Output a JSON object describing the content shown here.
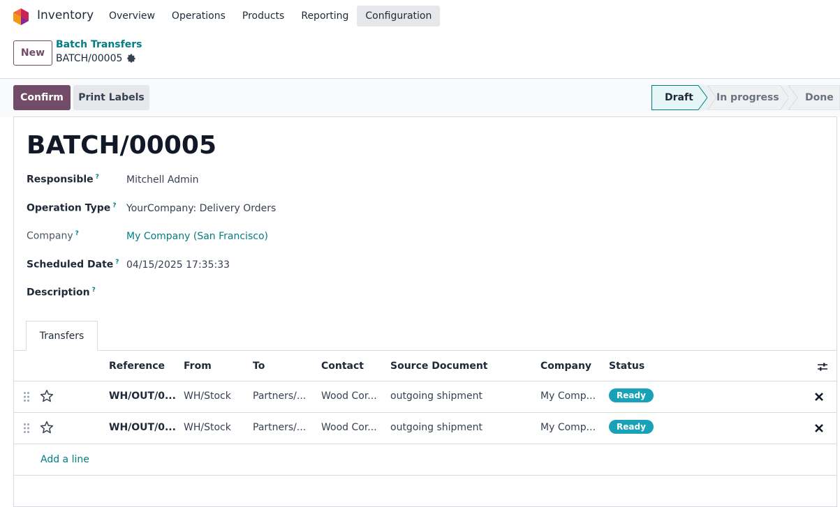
{
  "navbar": {
    "app_name": "Inventory",
    "menu": [
      "Overview",
      "Operations",
      "Products",
      "Reporting",
      "Configuration"
    ],
    "active_menu": "Configuration"
  },
  "control": {
    "new_label": "New",
    "breadcrumb_parent": "Batch Transfers",
    "record_name": "BATCH/00005"
  },
  "actions": {
    "confirm_label": "Confirm",
    "print_labels_label": "Print Labels"
  },
  "stages": [
    {
      "label": "Draft",
      "active": true
    },
    {
      "label": "In progress",
      "active": false
    },
    {
      "label": "Done",
      "active": false
    }
  ],
  "form": {
    "title": "BATCH/00005",
    "fields": [
      {
        "label": "Responsible",
        "help": "?",
        "value": "Mitchell Admin"
      },
      {
        "label": "Operation Type",
        "help": "?",
        "value": "YourCompany: Delivery Orders"
      },
      {
        "label": "Company",
        "help": "?",
        "value": "My Company (San Francisco)"
      },
      {
        "label": "Scheduled Date",
        "help": "?",
        "value": "04/15/2025 17:35:33"
      },
      {
        "label": "Description",
        "help": "?",
        "value": ""
      }
    ]
  },
  "tabs": {
    "transfers_label": "Transfers"
  },
  "table": {
    "headers": [
      "Reference",
      "From",
      "To",
      "Contact",
      "Source Document",
      "Company",
      "Status"
    ],
    "rows": [
      {
        "reference": "WH/OUT/0...",
        "from": "WH/Stock",
        "to": "Partners/...",
        "contact": "Wood Cor...",
        "source": "outgoing shipment",
        "company": "My Comp...",
        "status": "Ready"
      },
      {
        "reference": "WH/OUT/0...",
        "from": "WH/Stock",
        "to": "Partners/...",
        "contact": "Wood Cor...",
        "source": "outgoing shipment",
        "company": "My Comp...",
        "status": "Ready"
      }
    ],
    "add_line_label": "Add a line"
  },
  "colors": {
    "primary": "#714b67",
    "link": "#017e84",
    "badge_ready": "#17a2b8"
  }
}
